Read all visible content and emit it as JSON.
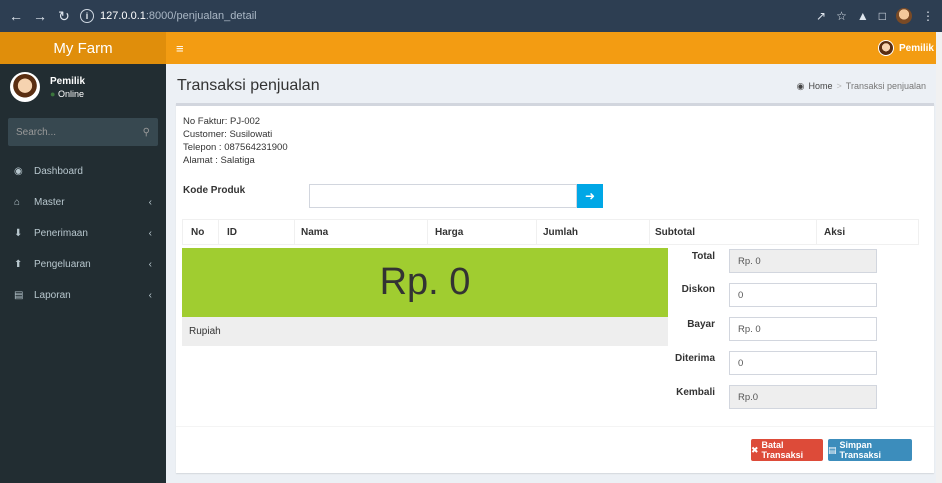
{
  "browser": {
    "back_icon": "arrow-left",
    "forward_icon": "arrow-right",
    "reload_icon": "reload",
    "url_host": "127.0.0.1",
    "url_path": ":8000/penjualan_detail"
  },
  "app": {
    "logo": "My Farm",
    "user_top": "Pemilik"
  },
  "sidebar": {
    "user_name": "Pemilik",
    "user_status": "Online",
    "search_placeholder": "Search...",
    "items": [
      {
        "label": "Dashboard",
        "icon": "dashboard-icon",
        "has_arrow": false
      },
      {
        "label": "Master",
        "icon": "bank-icon",
        "has_arrow": true
      },
      {
        "label": "Penerimaan",
        "icon": "download-icon",
        "has_arrow": true
      },
      {
        "label": "Pengeluaran",
        "icon": "upload-icon",
        "has_arrow": true
      },
      {
        "label": "Laporan",
        "icon": "report-icon",
        "has_arrow": true
      }
    ]
  },
  "content": {
    "page_title": "Transaksi penjualan",
    "breadcrumb": {
      "home": "Home",
      "current": "Transaksi penjualan"
    }
  },
  "invoice": {
    "no_faktur": "No Faktur: PJ-002",
    "customer": "Customer: Susilowati",
    "telepon": "Telepon  : 087564231900",
    "alamat": "Alamat   : Salatiga"
  },
  "kode_produk": {
    "label": "Kode Produk",
    "value": ""
  },
  "table": {
    "headers": [
      "No",
      "ID",
      "Nama",
      "Harga",
      "Jumlah",
      "Subtotal",
      "Aksi"
    ]
  },
  "display": {
    "amount": "Rp. 0",
    "terbilang": "Rupiah"
  },
  "summary": {
    "total_label": "Total",
    "total_value": "Rp. 0",
    "diskon_label": "Diskon",
    "diskon_value": "0",
    "bayar_label": "Bayar",
    "bayar_value": "Rp. 0",
    "diterima_label": "Diterima",
    "diterima_value": "0",
    "kembali_label": "Kembali",
    "kembali_value": "Rp.0"
  },
  "actions": {
    "cancel": "Batal Transaksi",
    "save": "Simpan Transaksi"
  },
  "colors": {
    "header_orange": "#f39c12",
    "logo_orange": "#e08e0b",
    "sidebar": "#222d32",
    "display_green": "#a0cd30",
    "btn_danger": "#dd4b39",
    "btn_primary": "#3c8dbc",
    "btn_info": "#00a7e6"
  }
}
